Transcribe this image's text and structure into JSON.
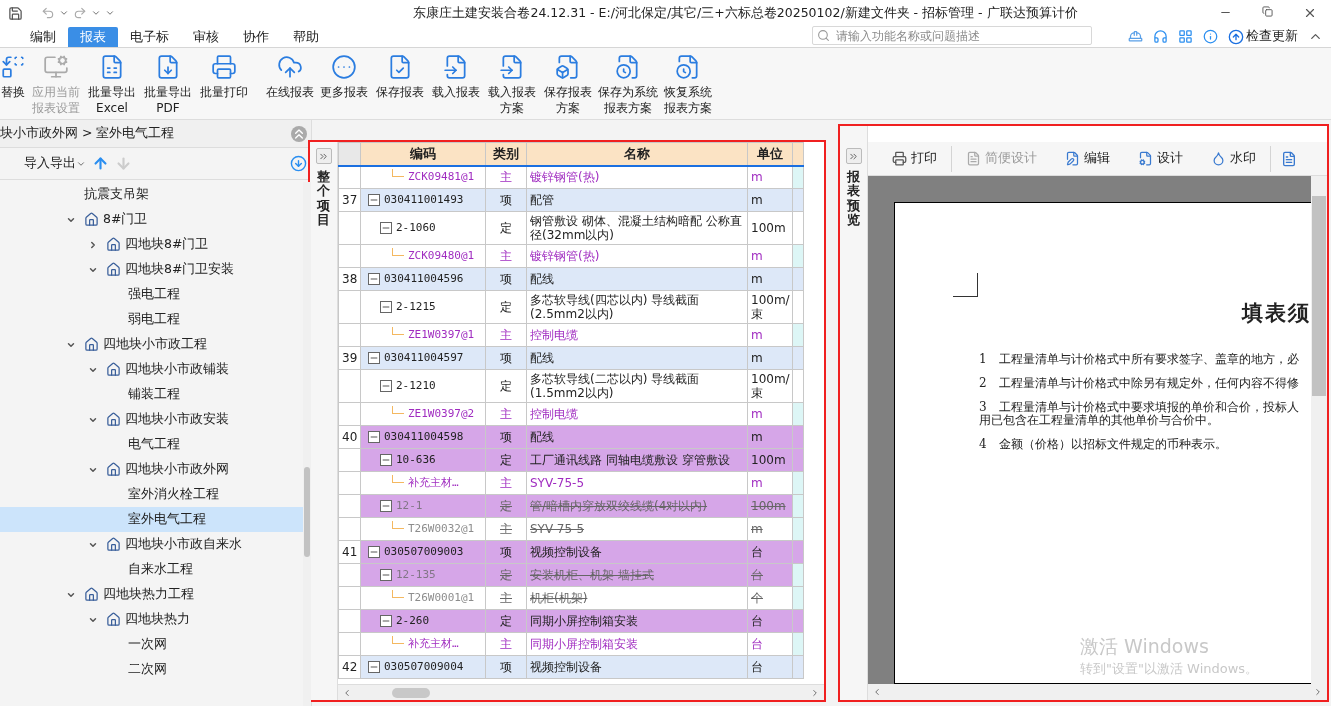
{
  "window": {
    "title": "东康庄土建安装合卷24.12.31 - E:/河北保定/其它/三+六标总卷20250102/新建文件夹 - 招标管理 - 广联达预算计价"
  },
  "menu_tabs": [
    {
      "label": "编制",
      "selected": false
    },
    {
      "label": "报表",
      "selected": true
    },
    {
      "label": "电子标",
      "selected": false
    },
    {
      "label": "审核",
      "selected": false
    },
    {
      "label": "协作",
      "selected": false
    },
    {
      "label": "帮助",
      "selected": false
    }
  ],
  "search": {
    "placeholder": "请输入功能名称或问题描述"
  },
  "update_button": "检查更新",
  "ribbon_groups": [
    [
      {
        "lines": [
          "替换"
        ],
        "disabled": false
      },
      {
        "lines": [
          "应用当前",
          "报表设置"
        ],
        "disabled": true
      },
      {
        "lines": [
          "批量导出",
          "Excel"
        ],
        "disabled": false
      },
      {
        "lines": [
          "批量导出",
          "PDF"
        ],
        "disabled": false
      },
      {
        "lines": [
          "批量打印"
        ],
        "disabled": false
      }
    ],
    [
      {
        "lines": [
          "在线报表"
        ],
        "disabled": false
      },
      {
        "lines": [
          "更多报表"
        ],
        "disabled": false
      },
      {
        "lines": [
          "保存报表"
        ],
        "disabled": false
      },
      {
        "lines": [
          "载入报表"
        ],
        "disabled": false
      },
      {
        "lines": [
          "载入报表",
          "方案"
        ],
        "disabled": false
      },
      {
        "lines": [
          "保存报表",
          "方案"
        ],
        "disabled": false
      },
      {
        "lines": [
          "保存为系统",
          "报表方案"
        ],
        "disabled": false
      },
      {
        "lines": [
          "恢复系统",
          "报表方案"
        ],
        "disabled": false
      }
    ]
  ],
  "left_panel": {
    "breadcrumb": "块小市政外网 > 室外电气工程",
    "import_export": "导入导出",
    "tree": [
      {
        "label": "抗震支吊架",
        "kind": "leaf",
        "selected": false
      },
      {
        "label": "8#门卫",
        "kind": "folder",
        "expanded": true,
        "selected": false,
        "children": [
          {
            "label": "四地块8#门卫",
            "kind": "folder",
            "expanded": false,
            "selected": false
          },
          {
            "label": "四地块8#门卫安装",
            "kind": "folder",
            "expanded": true,
            "selected": false,
            "children": [
              {
                "label": "强电工程",
                "kind": "leaf",
                "selected": false
              },
              {
                "label": "弱电工程",
                "kind": "leaf",
                "selected": false
              }
            ]
          }
        ]
      },
      {
        "label": "四地块小市政工程",
        "kind": "folder",
        "expanded": true,
        "selected": false,
        "children": [
          {
            "label": "四地块小市政铺装",
            "kind": "folder",
            "expanded": true,
            "selected": false,
            "children": [
              {
                "label": "铺装工程",
                "kind": "leaf",
                "selected": false
              }
            ]
          },
          {
            "label": "四地块小市政安装",
            "kind": "folder",
            "expanded": true,
            "selected": false,
            "children": [
              {
                "label": "电气工程",
                "kind": "leaf",
                "selected": false
              }
            ]
          },
          {
            "label": "四地块小市政外网",
            "kind": "folder",
            "expanded": true,
            "selected": false,
            "children": [
              {
                "label": "室外消火栓工程",
                "kind": "leaf",
                "selected": false
              },
              {
                "label": "室外电气工程",
                "kind": "leaf",
                "selected": true
              }
            ]
          },
          {
            "label": "四地块小市政自来水",
            "kind": "folder",
            "expanded": true,
            "selected": false,
            "children": [
              {
                "label": "自来水工程",
                "kind": "leaf",
                "selected": false
              }
            ]
          }
        ]
      },
      {
        "label": "四地块热力工程",
        "kind": "folder",
        "expanded": true,
        "selected": false,
        "children": [
          {
            "label": "四地块热力",
            "kind": "folder",
            "expanded": true,
            "selected": false,
            "children": [
              {
                "label": "一次网",
                "kind": "leaf",
                "selected": false
              },
              {
                "label": "二次网",
                "kind": "leaf",
                "selected": false
              }
            ]
          }
        ]
      }
    ]
  },
  "bill_panel": {
    "side_label": "整个项目",
    "columns": [
      "编码",
      "类别",
      "名称",
      "单位"
    ],
    "rows": [
      {
        "kind": "main",
        "no": "",
        "code": "ZCK09481@1",
        "type": "主",
        "name": "镀锌钢管(热)",
        "unit": "m",
        "highlighted": false,
        "disabled": false
      },
      {
        "kind": "item",
        "no": "37",
        "code": "030411001493",
        "type": "项",
        "name": "配管",
        "unit": "m",
        "highlighted": false,
        "disabled": false,
        "expanded": true
      },
      {
        "kind": "quota",
        "no": "",
        "code": "2-1060",
        "type": "定",
        "name": "钢管敷设 砌体、混凝土结构暗配 公称直径(32mm以内)",
        "unit": "100m",
        "highlighted": false,
        "disabled": false,
        "expanded": true
      },
      {
        "kind": "main",
        "no": "",
        "code": "ZCK09480@1",
        "type": "主",
        "name": "镀锌钢管(热)",
        "unit": "m",
        "highlighted": false,
        "disabled": false
      },
      {
        "kind": "item",
        "no": "38",
        "code": "030411004596",
        "type": "项",
        "name": "配线",
        "unit": "m",
        "highlighted": false,
        "disabled": false,
        "expanded": true
      },
      {
        "kind": "quota",
        "no": "",
        "code": "2-1215",
        "type": "定",
        "name": "多芯软导线(四芯以内) 导线截面(2.5mm2以内)",
        "unit": "100m/束",
        "highlighted": false,
        "disabled": false,
        "expanded": true
      },
      {
        "kind": "main",
        "no": "",
        "code": "ZE1W0397@1",
        "type": "主",
        "name": "控制电缆",
        "unit": "m",
        "highlighted": false,
        "disabled": false
      },
      {
        "kind": "item",
        "no": "39",
        "code": "030411004597",
        "type": "项",
        "name": "配线",
        "unit": "m",
        "highlighted": false,
        "disabled": false,
        "expanded": true
      },
      {
        "kind": "quota",
        "no": "",
        "code": "2-1210",
        "type": "定",
        "name": "多芯软导线(二芯以内) 导线截面(1.5mm2以内)",
        "unit": "100m/束",
        "highlighted": false,
        "disabled": false,
        "expanded": true
      },
      {
        "kind": "main",
        "no": "",
        "code": "ZE1W0397@2",
        "type": "主",
        "name": "控制电缆",
        "unit": "m",
        "highlighted": false,
        "disabled": false
      },
      {
        "kind": "item",
        "no": "40",
        "code": "030411004598",
        "type": "项",
        "name": "配线",
        "unit": "m",
        "highlighted": true,
        "disabled": false,
        "expanded": true
      },
      {
        "kind": "quota",
        "no": "",
        "code": "10-636",
        "type": "定",
        "name": "工厂通讯线路 同轴电缆敷设 穿管敷设",
        "unit": "100m",
        "highlighted": true,
        "disabled": false,
        "expanded": true
      },
      {
        "kind": "main",
        "no": "",
        "code": "补充主材…",
        "type": "主",
        "name": "SYV-75-5",
        "unit": "m",
        "highlighted": false,
        "disabled": false
      },
      {
        "kind": "quota",
        "no": "",
        "code": "12-1",
        "type": "定",
        "name": "管/暗槽内穿放双绞线缆(4对以内)",
        "unit": "100m",
        "highlighted": true,
        "disabled": true,
        "expanded": true
      },
      {
        "kind": "main",
        "no": "",
        "code": "T26W0032@1",
        "type": "主",
        "name": "SYV-75-5",
        "unit": "m",
        "highlighted": false,
        "disabled": true
      },
      {
        "kind": "item",
        "no": "41",
        "code": "030507009003",
        "type": "项",
        "name": "视频控制设备",
        "unit": "台",
        "highlighted": true,
        "disabled": false,
        "expanded": true
      },
      {
        "kind": "quota",
        "no": "",
        "code": "12-135",
        "type": "定",
        "name": "安装机柜、机架 墙挂式",
        "unit": "台",
        "highlighted": true,
        "disabled": true,
        "expanded": true
      },
      {
        "kind": "main",
        "no": "",
        "code": "T26W0001@1",
        "type": "主",
        "name": "机柜(机架)",
        "unit": "个",
        "highlighted": false,
        "disabled": true
      },
      {
        "kind": "quota",
        "no": "",
        "code": "2-260",
        "type": "定",
        "name": "同期小屏控制箱安装",
        "unit": "台",
        "highlighted": true,
        "disabled": false,
        "expanded": true
      },
      {
        "kind": "main",
        "no": "",
        "code": "补充主材…",
        "type": "主",
        "name": "同期小屏控制箱安装",
        "unit": "台",
        "highlighted": false,
        "disabled": false
      },
      {
        "kind": "item",
        "no": "42",
        "code": "030507009004",
        "type": "项",
        "name": "视频控制设备",
        "unit": "台",
        "highlighted": false,
        "disabled": false,
        "expanded": true
      }
    ]
  },
  "preview_panel": {
    "side_label": "报表预览",
    "toolbar": [
      {
        "label": "打印",
        "disabled": false,
        "separator_after": true
      },
      {
        "label": "简便设计",
        "disabled": true,
        "separator_after": false
      },
      {
        "label": "编辑",
        "disabled": false,
        "separator_after": false
      },
      {
        "label": "设计",
        "disabled": false,
        "separator_after": false
      },
      {
        "label": "水印",
        "disabled": false,
        "separator_after": true
      }
    ],
    "page": {
      "title": "填表须",
      "notes": [
        {
          "no": "1",
          "text": "工程量清单与计价格式中所有要求签字、盖章的地方，必"
        },
        {
          "no": "2",
          "text": "工程量清单与计价格式中除另有规定外，任何内容不得修"
        },
        {
          "no": "3",
          "text": "工程量清单与计价格式中要求填报的单价和合价，投标人",
          "continuation": "用已包含在工程量清单的其他单价与合价中。"
        },
        {
          "no": "4",
          "text": "金额（价格）以招标文件规定的币种表示。"
        }
      ]
    }
  },
  "activation_notice": {
    "title": "激活 Windows",
    "hint": "转到\"设置\"以激活 Windows。"
  }
}
